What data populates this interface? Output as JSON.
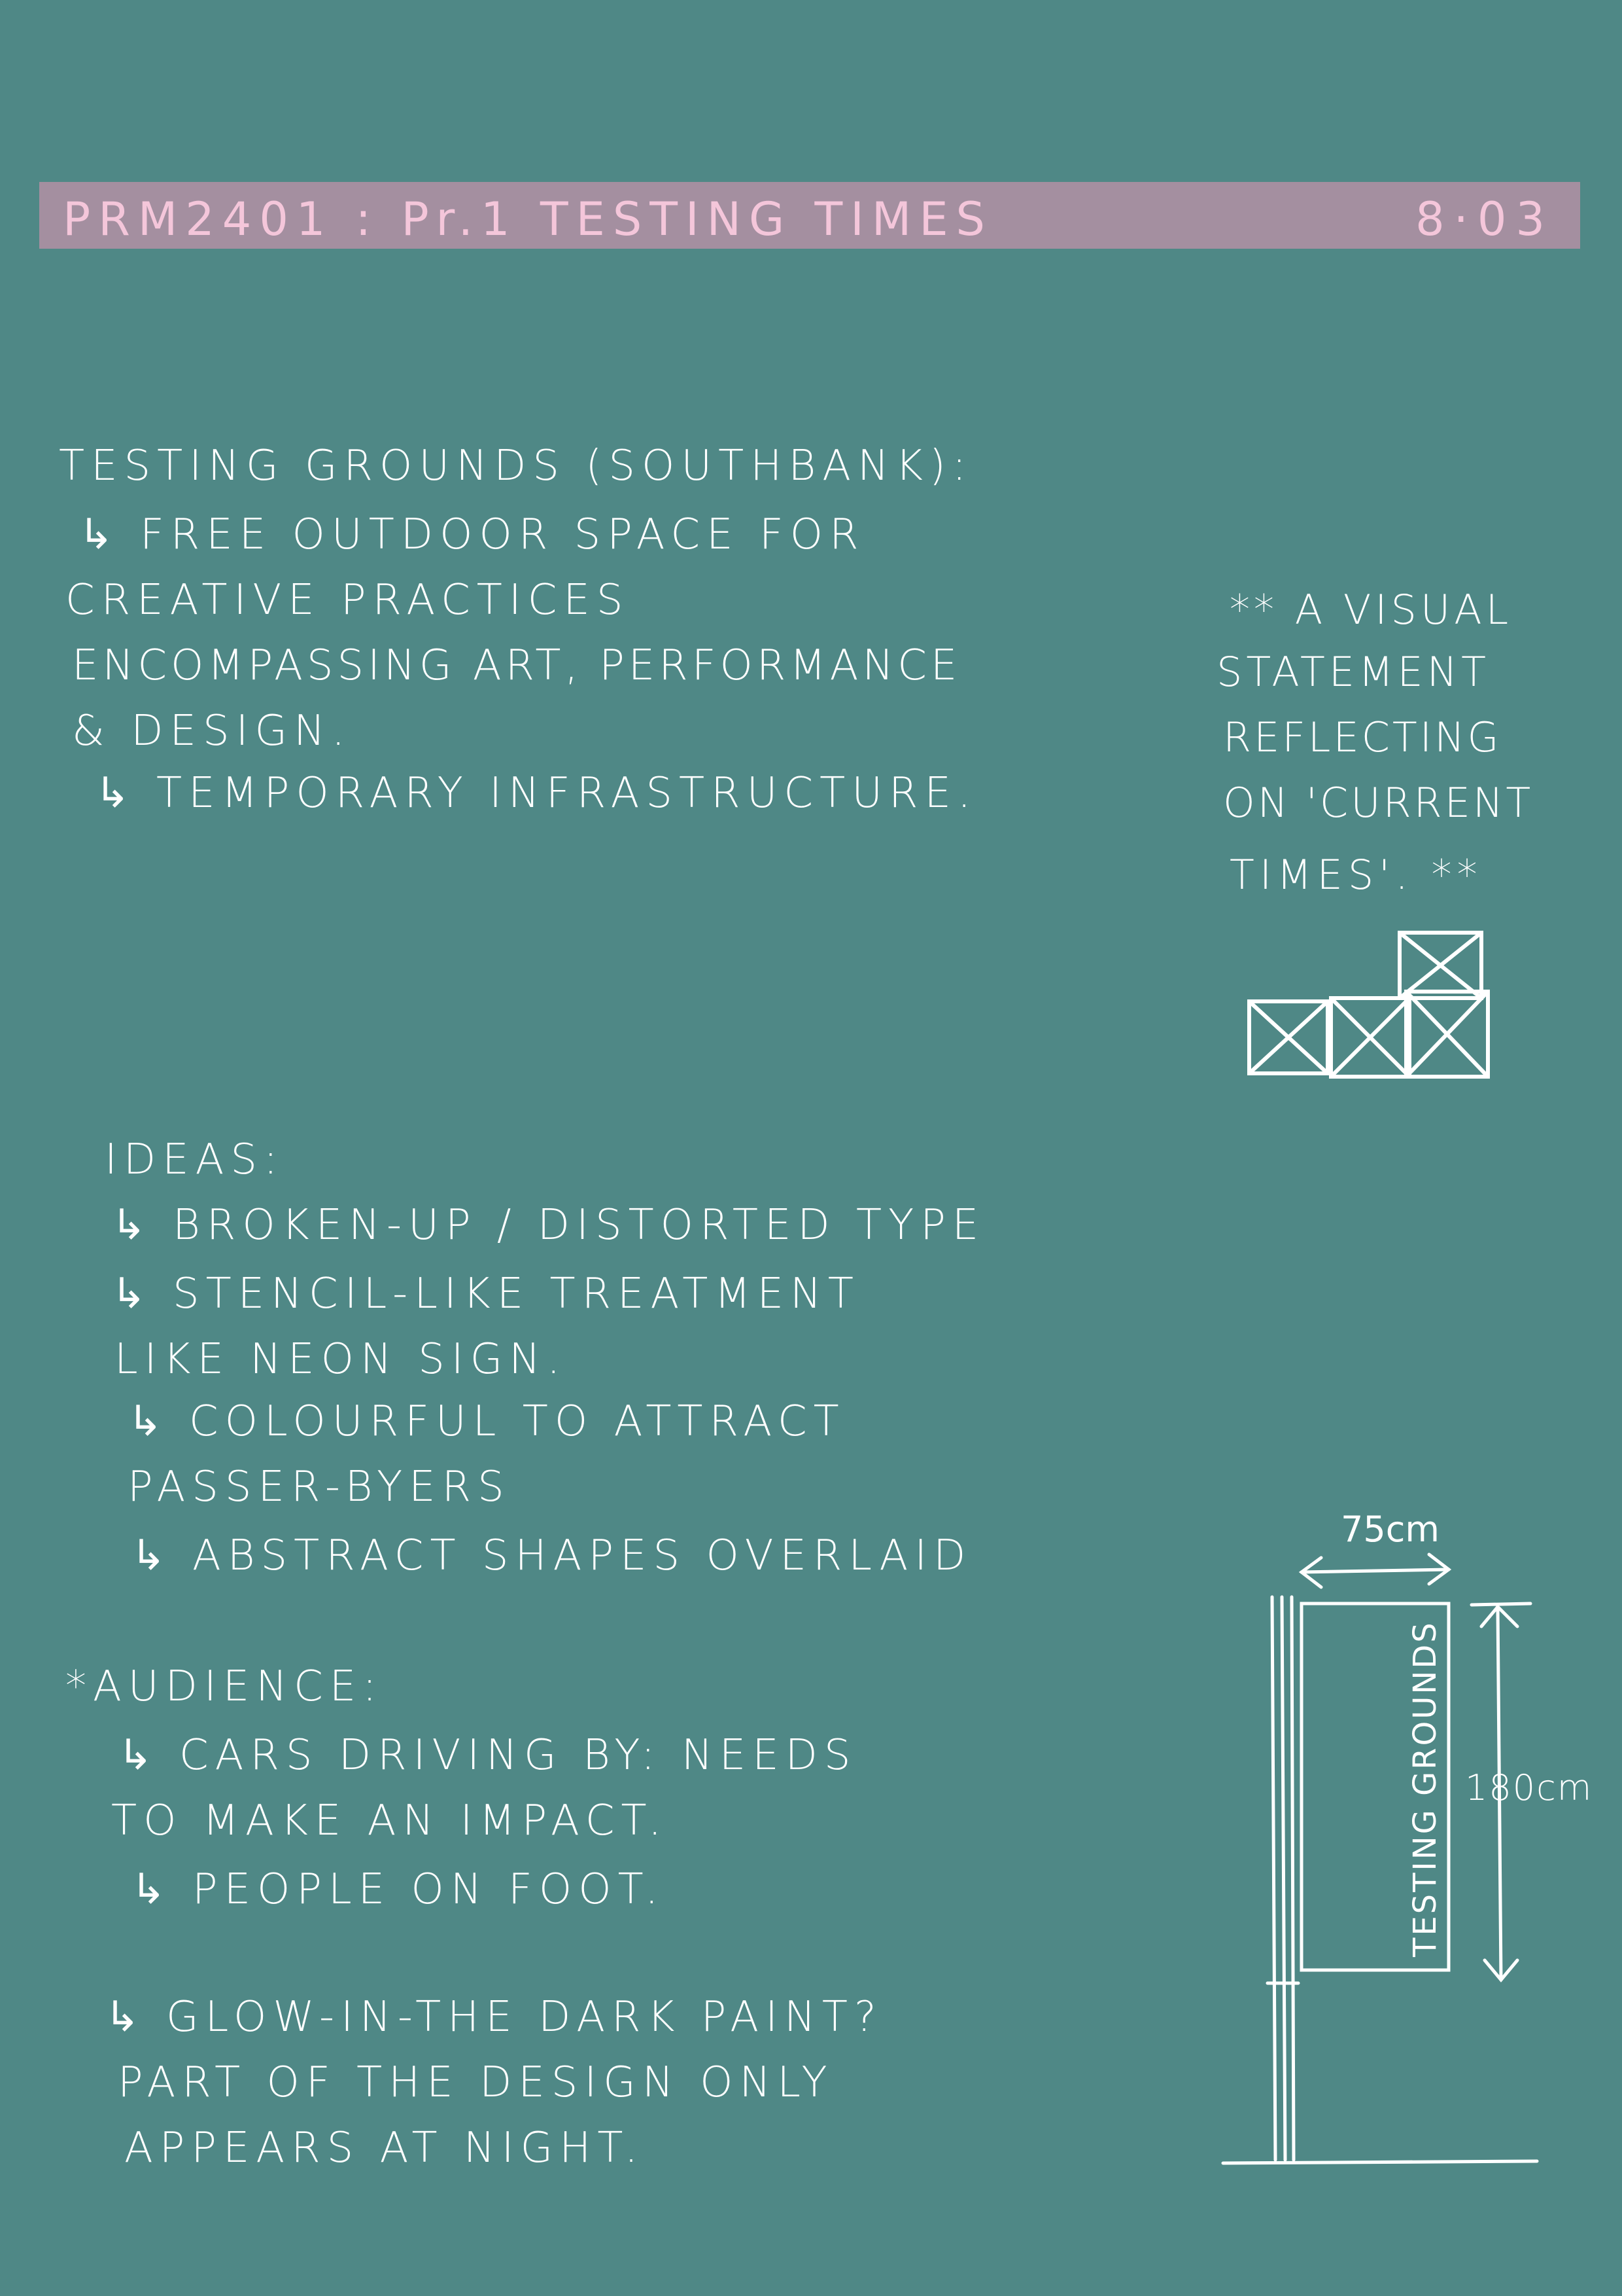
{
  "header": {
    "title": "PRM2401 : Pr.1 TESTING TIMES",
    "date": "8·03"
  },
  "testing_grounds": {
    "heading": "TESTING GROUNDS (SOUTHBANK):",
    "lines": [
      "↳ FREE OUTDOOR SPACE FOR",
      "CREATIVE PRACTICES",
      "ENCOMPASSING ART, PERFORMANCE",
      "& DESIGN.",
      "↳ TEMPORARY INFRASTRUCTURE."
    ]
  },
  "statement_note": {
    "lines": [
      "** A VISUAL",
      "STATEMENT",
      "REFLECTING",
      "ON 'CURRENT",
      "TIMES'. **"
    ]
  },
  "ideas": {
    "heading": "IDEAS:",
    "lines": [
      "↳ BROKEN-UP / DISTORTED TYPE",
      "↳ STENCIL-LIKE TREATMENT",
      "LIKE NEON SIGN.",
      "↳ COLOURFUL TO ATTRACT",
      "PASSER-BYERS",
      "↳ ABSTRACT SHAPES OVERLAID"
    ]
  },
  "audience": {
    "heading": "*AUDIENCE:",
    "lines": [
      "↳ CARS DRIVING BY: NEEDS",
      "TO MAKE AN IMPACT.",
      "↳ PEOPLE ON FOOT."
    ]
  },
  "glow": {
    "lines": [
      "↳ GLOW-IN-THE DARK PAINT?",
      "PART OF THE DESIGN ONLY",
      "APPEARS AT NIGHT."
    ]
  },
  "banner_sketch": {
    "width_label": "75cm",
    "height_label": "180cm",
    "banner_text": "TESTING GROUNDS"
  },
  "colors": {
    "background": "#4f8886",
    "header_bar": "#a48fa0",
    "header_text": "#f4c6da",
    "ink": "#ffffff"
  }
}
